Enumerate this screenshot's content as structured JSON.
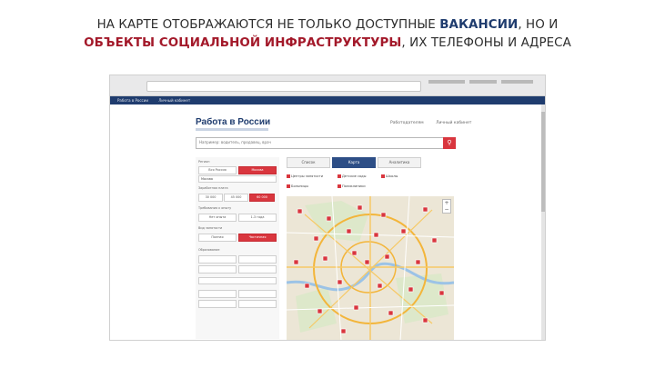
{
  "slide": {
    "line1_pre": "НА КАРТЕ ОТОБРАЖАЮТСЯ НЕ ТОЛЬКО ДОСТУПНЫЕ ",
    "line1_bold": "ВАКАНСИИ",
    "line1_post": ", НО И",
    "line2_bold": "ОБЪЕКТЫ СОЦИАЛЬНОЙ ИНФРАСТРУКТУРЫ",
    "line2_post": ", ИХ ТЕЛЕФОНЫ И АДРЕСА"
  },
  "colors": {
    "brand": "#1f3c6e",
    "accent": "#d9363e",
    "highlight_red": "#a3192a"
  },
  "site": {
    "topbar": [
      "Работа в России",
      "Личный кабинет"
    ],
    "logo": "Работа в России",
    "top_links": [
      "Работодателям",
      "Личный кабинет"
    ],
    "search_placeholder": "Например: водитель, продавец, врач",
    "search_icon": "search-icon"
  },
  "filters": {
    "groups": [
      "Регион",
      "Заработная плата",
      "Требования к опыту",
      "Вид занятости",
      "Образование"
    ],
    "buttons": [
      "Вся Россия",
      "Москва",
      "Москва",
      "30 000",
      "45 000",
      "60 000",
      "Нет опыта",
      "1-3 года",
      "Полная",
      "Частичная"
    ]
  },
  "tabs": [
    "Список",
    "Карта",
    "Аналитика"
  ],
  "legend": [
    "Центры занятости",
    "Детские сады",
    "Школы",
    "Больницы",
    "Поликлиники"
  ],
  "map": {
    "zoom_in": "+",
    "zoom_out": "−"
  }
}
